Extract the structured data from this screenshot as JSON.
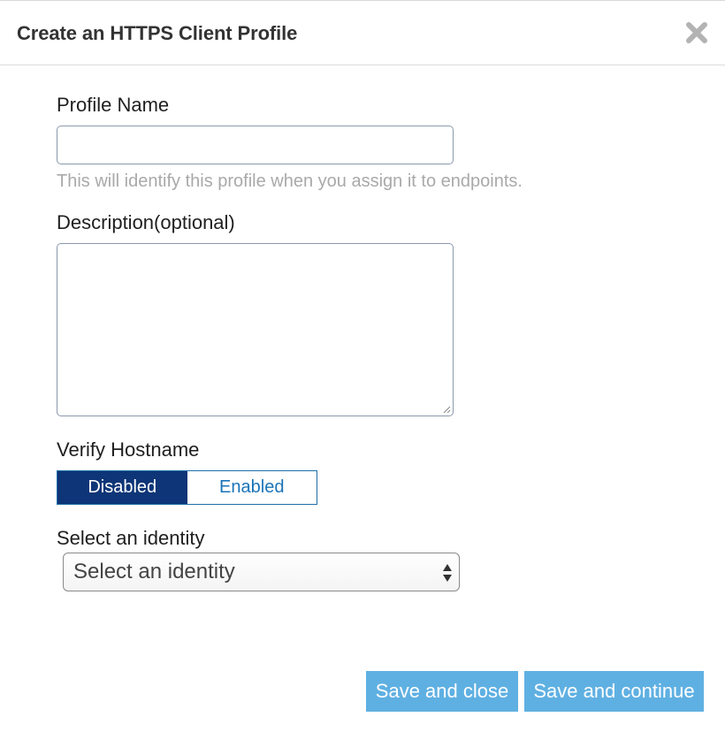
{
  "dialog": {
    "title": "Create an HTTPS Client Profile",
    "close_icon": "close-x-icon"
  },
  "form": {
    "profile_name": {
      "label": "Profile Name",
      "value": "",
      "help": "This will identify this profile when you assign it to endpoints."
    },
    "description": {
      "label": "Description(optional)",
      "value": ""
    },
    "verify_hostname": {
      "label": "Verify Hostname",
      "options": [
        "Disabled",
        "Enabled"
      ],
      "selected": "Disabled"
    },
    "identity": {
      "label": "Select an identity",
      "selected_text": "Select an identity"
    }
  },
  "footer": {
    "save_close_label": "Save and close",
    "save_continue_label": "Save and continue"
  },
  "colors": {
    "toggle_active_bg": "#0d3577",
    "toggle_inactive_text": "#1a73b8",
    "primary_button_bg": "#5fb0e2",
    "help_text": "#a9a9a9"
  }
}
